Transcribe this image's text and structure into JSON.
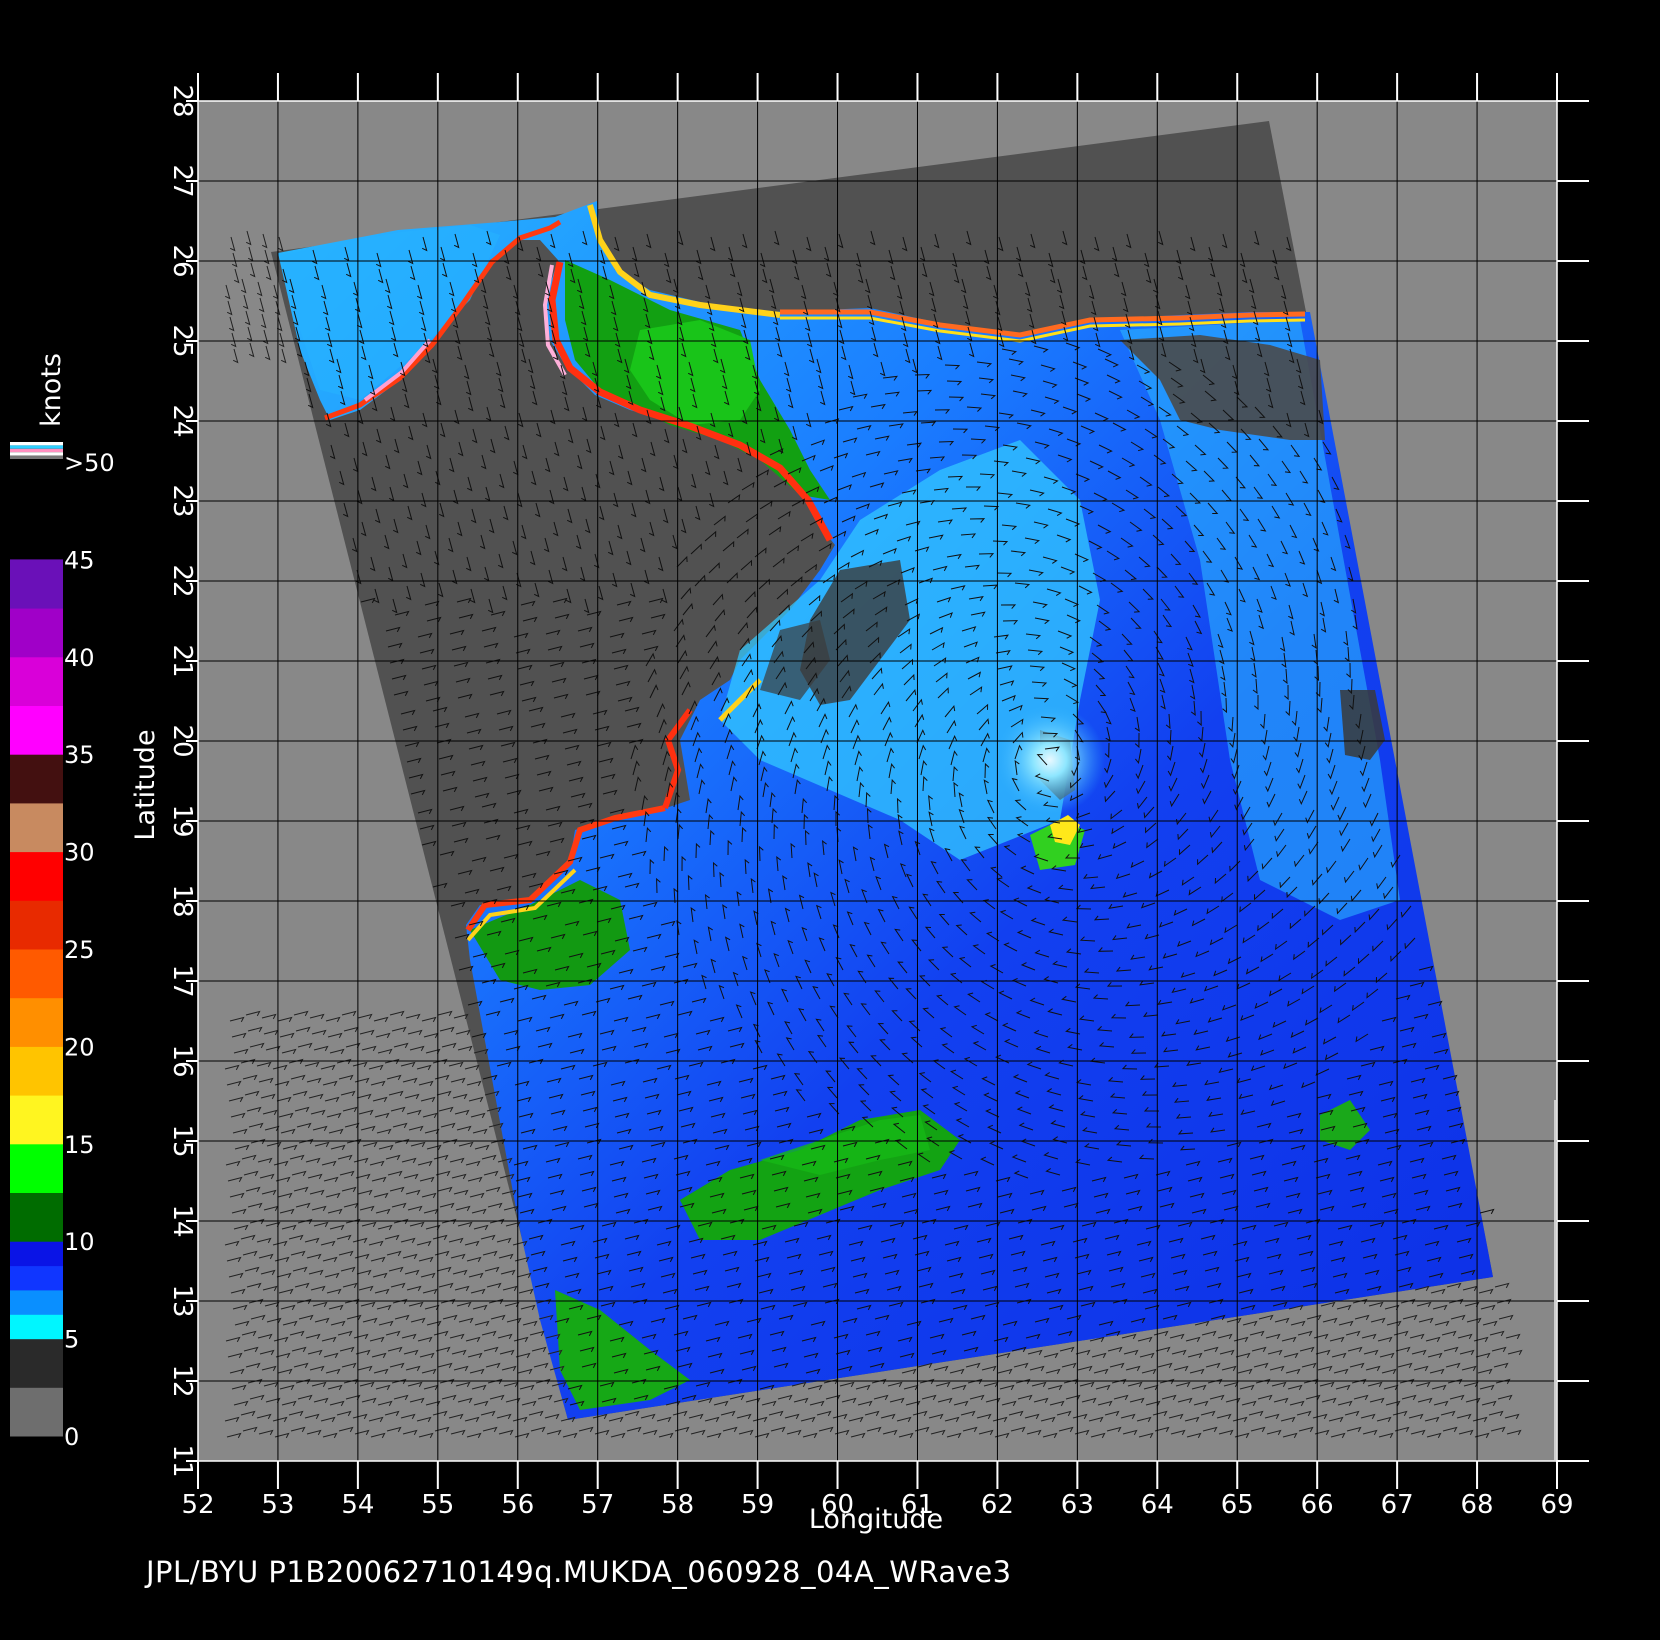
{
  "map": {
    "x_axis": {
      "label": "Longitude",
      "min": 52,
      "max": 69,
      "ticks": [
        52,
        53,
        54,
        55,
        56,
        57,
        58,
        59,
        60,
        61,
        62,
        63,
        64,
        65,
        66,
        67,
        68,
        69
      ]
    },
    "y_axis": {
      "label": "Latitude",
      "min": 11,
      "max": 28,
      "ticks": [
        11,
        12,
        13,
        14,
        15,
        16,
        17,
        18,
        19,
        20,
        21,
        22,
        23,
        24,
        25,
        26,
        27,
        28
      ]
    },
    "grid": true,
    "colors": {
      "background": "#000000",
      "frame": "#888888",
      "no_data_swath": "#515151",
      "grid_line": "#000000",
      "calm": "#0b2fe0",
      "moderate": "#1a8cff",
      "light": "#2fc7ff",
      "strong": "#1aa81a",
      "coast_yellow": "#ffd21a",
      "coast_red": "#ff2a10",
      "coast_pink": "#ff9fd0",
      "low_wind_gray": "#3c3c3c"
    },
    "features": [
      "land-mass-swath",
      "wind-speed-swath",
      "wind-barbs",
      "cyclone-center"
    ]
  },
  "legend": {
    "unit": "knots",
    "labels": [
      ">50",
      "45",
      "40",
      "35",
      "30",
      "25",
      "20",
      "15",
      "10",
      "5",
      "0"
    ],
    "bands": [
      {
        "from": 0,
        "to": 5,
        "colors": [
          "#6e6e6e",
          "#2a2a2a"
        ]
      },
      {
        "from": 5,
        "to": 15,
        "colors": [
          "#00f6ff",
          "#0a8fff",
          "#1036ff",
          "#0a14e6"
        ]
      },
      {
        "from": 15,
        "to": 20,
        "colors": [
          "#006c00",
          "#00ff00"
        ]
      },
      {
        "from": 20,
        "to": 25,
        "colors": [
          "#fff520",
          "#ffc400"
        ]
      },
      {
        "from": 25,
        "to": 30,
        "colors": [
          "#ff8f00",
          "#ff5a00"
        ]
      },
      {
        "from": 30,
        "to": 35,
        "colors": [
          "#e82a00",
          "#ff0000"
        ]
      },
      {
        "from": 35,
        "to": 40,
        "colors": [
          "#c88a60",
          "#431010"
        ]
      },
      {
        "from": 40,
        "to": 45,
        "colors": [
          "#ff00ff",
          "#d900d9"
        ]
      },
      {
        "from": 45,
        "to": 50,
        "colors": [
          "#a000c8",
          "#6a10b8"
        ]
      }
    ],
    "top_stripe_colors": [
      "#ffffff",
      "#2fd0ff",
      "#ff90c0",
      "#ffffff",
      "#777777"
    ]
  },
  "footer": {
    "text": "JPL/BYU  P1B20062710149q.MUKDA_060928_04A_WRave3"
  }
}
